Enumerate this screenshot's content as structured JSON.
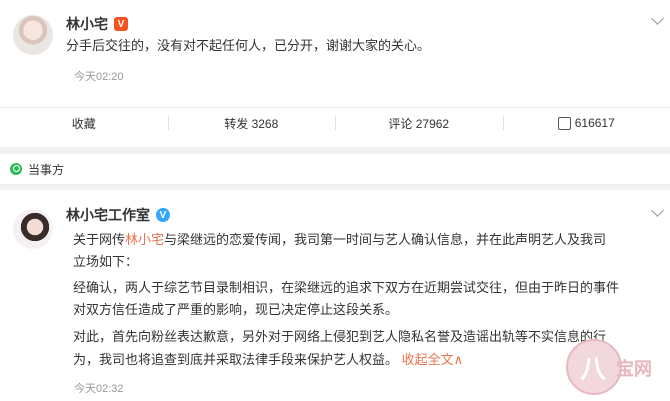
{
  "post1": {
    "author": "林小宅",
    "badge_glyph": "V",
    "text": "分手后交往的，没有对不起任何人，已分开，谢谢大家的关心。",
    "time": "今天02:20",
    "actions": {
      "collect_label": "收藏",
      "repost_label": "转发 3268",
      "comment_label": "评论 27962",
      "like_count": "616617"
    }
  },
  "section": {
    "label": "当事方"
  },
  "post2": {
    "author": "林小宅工作室",
    "verified_glyph": "V",
    "lines": {
      "l1_pre": "关于网传",
      "l1_mention": "林小宅",
      "l1_post": "与梁继远的恋爱传闻，我司第一时间与艺人确认信息，并在此声明艺人及我司",
      "l2": "立场如下：",
      "l3": "经确认，两人于综艺节目录制相识，在梁继远的追求下双方在近期尝试交往，但由于昨日的事件",
      "l4": "对双方信任造成了严重的影响，现已决定停止这段关系。",
      "l5": "对此，首先向粉丝表达歉意，另外对于网络上侵犯到艺人隐私名誉及造谣出轨等不实信息的行",
      "l6": "为，我司也将追查到底并采取法律手段来保护艺人权益。",
      "collapse_link": "收起全文",
      "collapse_arrow": "∧"
    },
    "time": "今天02:32"
  },
  "watermark": {
    "glyph": "八",
    "text": "宝网"
  },
  "colors": {
    "accent_orange": "#eb7350",
    "vip_orange": "#f7531e",
    "verified_blue": "#33a7ff",
    "section_green": "#2dbb55"
  }
}
